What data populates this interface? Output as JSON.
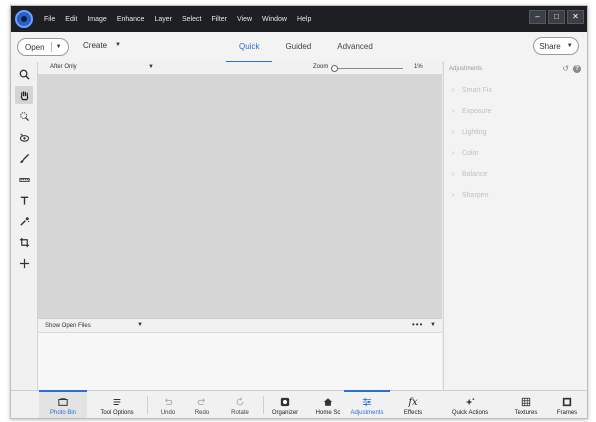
{
  "menubar": {
    "items": [
      "File",
      "Edit",
      "Image",
      "Enhance",
      "Layer",
      "Select",
      "Filter",
      "View",
      "Window",
      "Help"
    ],
    "controls": [
      "–",
      "□",
      "✕"
    ]
  },
  "topbar": {
    "open_label": "Open",
    "create_label": "Create",
    "tabs": [
      {
        "label": "Quick",
        "active": true
      },
      {
        "label": "Guided",
        "active": false
      },
      {
        "label": "Advanced",
        "active": false
      }
    ],
    "share_label": "Share"
  },
  "toolbox": {
    "tools": [
      "zoom-tool",
      "hand-tool",
      "quick-selection-tool",
      "red-eye-tool",
      "whiten-teeth-tool",
      "straighten-tool",
      "type-tool",
      "spot-healing-tool",
      "crop-tool",
      "move-tool"
    ],
    "active": "hand-tool"
  },
  "view": {
    "selected": "After Only",
    "zoom_label": "Zoom",
    "zoom_value": "1%",
    "zoom_level": 0.01
  },
  "photo_bin": {
    "filter": "Show Open Files",
    "more": "•••"
  },
  "panel": {
    "title": "Adjustments",
    "items": [
      "Smart Fix",
      "Exposure",
      "Lighting",
      "Color",
      "Balance",
      "Sharpen"
    ]
  },
  "taskbar": {
    "photo_bin": "Photo Bin",
    "tool_options": "Tool Options",
    "undo": "Undo",
    "redo": "Redo",
    "rotate": "Rotate",
    "organizer": "Organizer",
    "home_screen": "Home Sc",
    "adjustments": "Adjustments",
    "effects": "Effects",
    "quick_actions": "Quick Actions",
    "textures": "Textures",
    "frames": "Frames",
    "effects_glyph": "fx"
  },
  "colors": {
    "accent": "#2a6fd6",
    "menubar_bg": "#1d1f23",
    "canvas_bg": "#d6d6d6"
  }
}
